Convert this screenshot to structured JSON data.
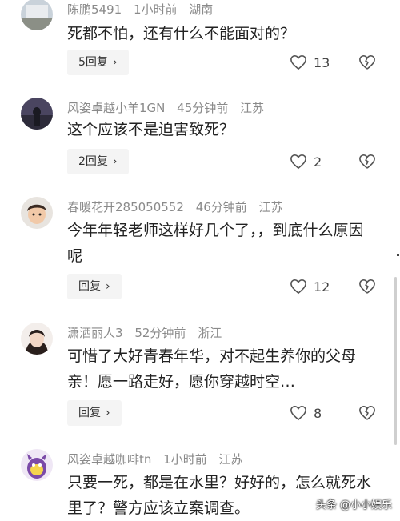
{
  "comments": [
    {
      "user": "陈鹏5491",
      "time": "1小时前",
      "location": "湖南",
      "text": "死都不怕，还有什么不能面对的？",
      "reply_label": "5回复",
      "likes": "13"
    },
    {
      "user": "风姿卓越小羊1GN",
      "time": "45分钟前",
      "location": "江苏",
      "text": "这个应该不是迫害致死？",
      "reply_label": "2回复",
      "likes": "2"
    },
    {
      "user": "春暖花开285050552",
      "time": "46分钟前",
      "location": "江苏",
      "text": "今年年轻老师这样好几个了，，到底什么原因呢",
      "reply_label": "回复",
      "likes": "12"
    },
    {
      "user": "潇洒丽人3",
      "time": "52分钟前",
      "location": "浙江",
      "text": "可惜了大好青春年华，对不起生养你的父母亲！愿一路走好，愿你穿越时空…",
      "reply_label": "回复",
      "likes": "8"
    },
    {
      "user": "风姿卓越咖啡tn",
      "time": "1小时前",
      "location": "江苏",
      "text": "只要一死，都是在水里？好好的，怎么就死水里了？警方应该立案调查。",
      "reply_label": "",
      "likes": ""
    }
  ],
  "watermark": "头条 @小小娱乐",
  "icons": {
    "like": "heart-outline-icon",
    "dislike": "broken-heart-icon",
    "reply_arrow": "chevron-right-icon"
  }
}
